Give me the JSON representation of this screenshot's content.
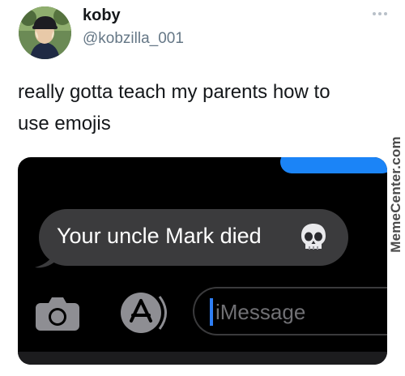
{
  "tweet": {
    "display_name": "koby",
    "handle": "@kobzilla_001",
    "text": "really gotta teach my parents how to\nuse emojis",
    "more_icon": "more-horizontal-icon"
  },
  "screenshot": {
    "received_message": "Your uncle Mark died",
    "emoji": "skull-emoji",
    "input_placeholder": "iMessage",
    "icons": [
      "camera-icon",
      "app-store-icon"
    ],
    "colors": {
      "background": "#000000",
      "received_bubble": "#3b3b3d",
      "sent_bubble": "#1b84f7",
      "caret": "#2f7ff5"
    }
  },
  "watermark": {
    "text": "MemeCenter.com"
  }
}
